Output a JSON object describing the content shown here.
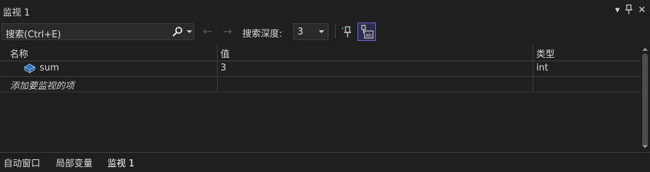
{
  "window": {
    "title": "监视 1"
  },
  "title_icons": {
    "menu": "▾",
    "pin": "⊣",
    "close": "✕"
  },
  "toolbar": {
    "search_text": "搜索(Ctrl+E)",
    "back_arrow": "←",
    "forward_arrow": "→",
    "depth_label": "搜索深度:",
    "depth_value": "3"
  },
  "grid": {
    "headers": [
      "名称",
      "值",
      "类型"
    ],
    "rows": [
      {
        "name": "sum",
        "value": "3",
        "type": "int"
      }
    ],
    "add_placeholder": "添加要监视的项"
  },
  "tabs": [
    "自动窗口",
    "局部变量",
    "监视 1"
  ],
  "colors": {
    "accent_border": "#6b6bd6",
    "background": "#1f1f1f"
  },
  "icons": [
    "search-icon",
    "pin-icon",
    "hex-ab-icon",
    "variable-icon"
  ]
}
